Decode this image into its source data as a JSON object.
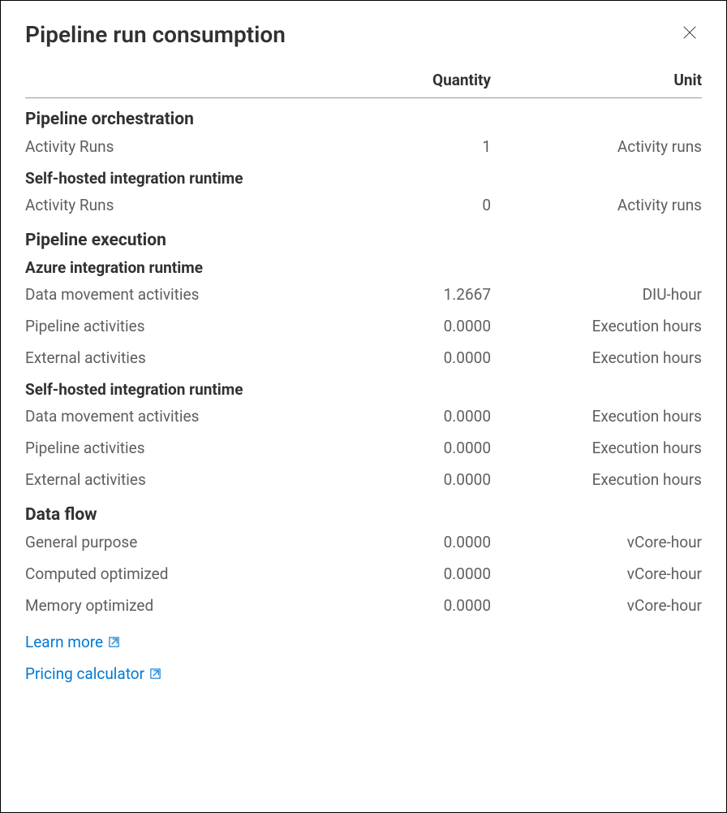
{
  "title": "Pipeline run consumption",
  "columns": {
    "quantity": "Quantity",
    "unit": "Unit"
  },
  "sections": {
    "pipeline_orchestration": {
      "title": "Pipeline orchestration",
      "rows": [
        {
          "label": "Activity Runs",
          "quantity": "1",
          "unit": "Activity runs"
        }
      ]
    },
    "self_hosted_1": {
      "title": "Self-hosted integration runtime",
      "rows": [
        {
          "label": "Activity Runs",
          "quantity": "0",
          "unit": "Activity runs"
        }
      ]
    },
    "pipeline_execution": {
      "title": "Pipeline execution"
    },
    "azure_ir": {
      "title": "Azure integration runtime",
      "rows": [
        {
          "label": "Data movement activities",
          "quantity": "1.2667",
          "unit": "DIU-hour"
        },
        {
          "label": "Pipeline activities",
          "quantity": "0.0000",
          "unit": "Execution hours"
        },
        {
          "label": "External activities",
          "quantity": "0.0000",
          "unit": "Execution hours"
        }
      ]
    },
    "self_hosted_2": {
      "title": "Self-hosted integration runtime",
      "rows": [
        {
          "label": "Data movement activities",
          "quantity": "0.0000",
          "unit": "Execution hours"
        },
        {
          "label": "Pipeline activities",
          "quantity": "0.0000",
          "unit": "Execution hours"
        },
        {
          "label": "External activities",
          "quantity": "0.0000",
          "unit": "Execution hours"
        }
      ]
    },
    "data_flow": {
      "title": "Data flow",
      "rows": [
        {
          "label": "General purpose",
          "quantity": "0.0000",
          "unit": "vCore-hour"
        },
        {
          "label": "Computed optimized",
          "quantity": "0.0000",
          "unit": "vCore-hour"
        },
        {
          "label": "Memory optimized",
          "quantity": "0.0000",
          "unit": "vCore-hour"
        }
      ]
    }
  },
  "links": {
    "learn_more": "Learn more",
    "pricing_calculator": "Pricing calculator"
  }
}
